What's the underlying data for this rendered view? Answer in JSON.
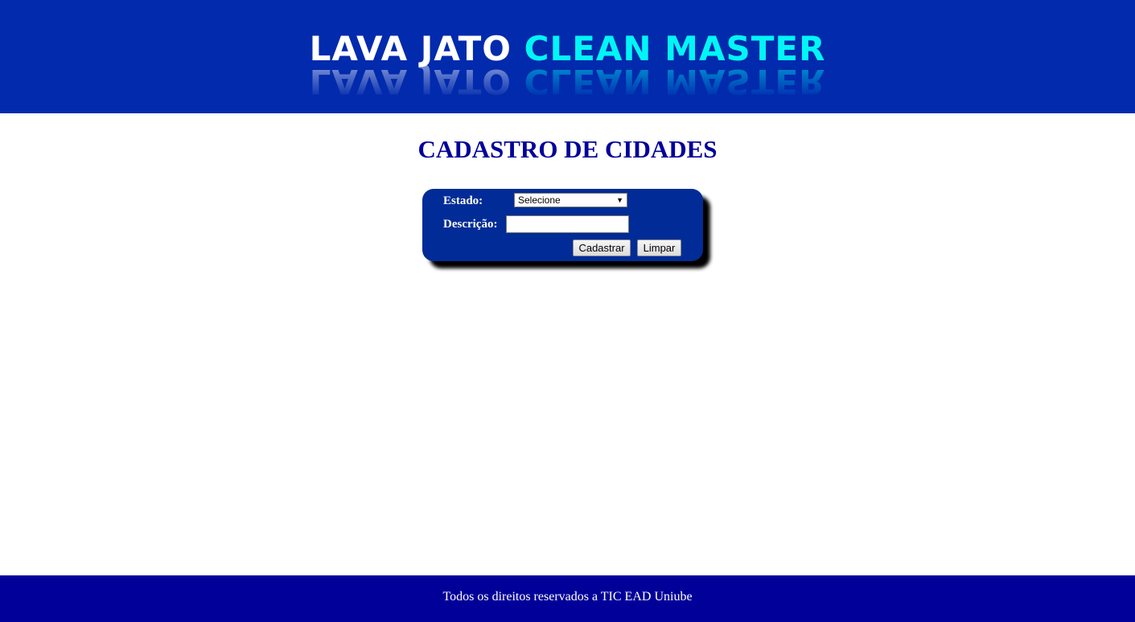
{
  "header": {
    "logo_part1": "LAVA JATO",
    "logo_part2": "CLEAN MASTER",
    "background": "#012aad",
    "accent": "#00f6f6"
  },
  "page_title": "CADASTRO DE CIDADES",
  "form": {
    "estado_label": "Estado:",
    "estado_selected": "Selecione",
    "descricao_label": "Descrição:",
    "descricao_value": "",
    "submit_label": "Cadastrar",
    "reset_label": "Limpar",
    "panel_color": "#012c97"
  },
  "footer": {
    "text": "Todos os direitos reservados a TIC EAD Uniube",
    "background": "#010199"
  }
}
